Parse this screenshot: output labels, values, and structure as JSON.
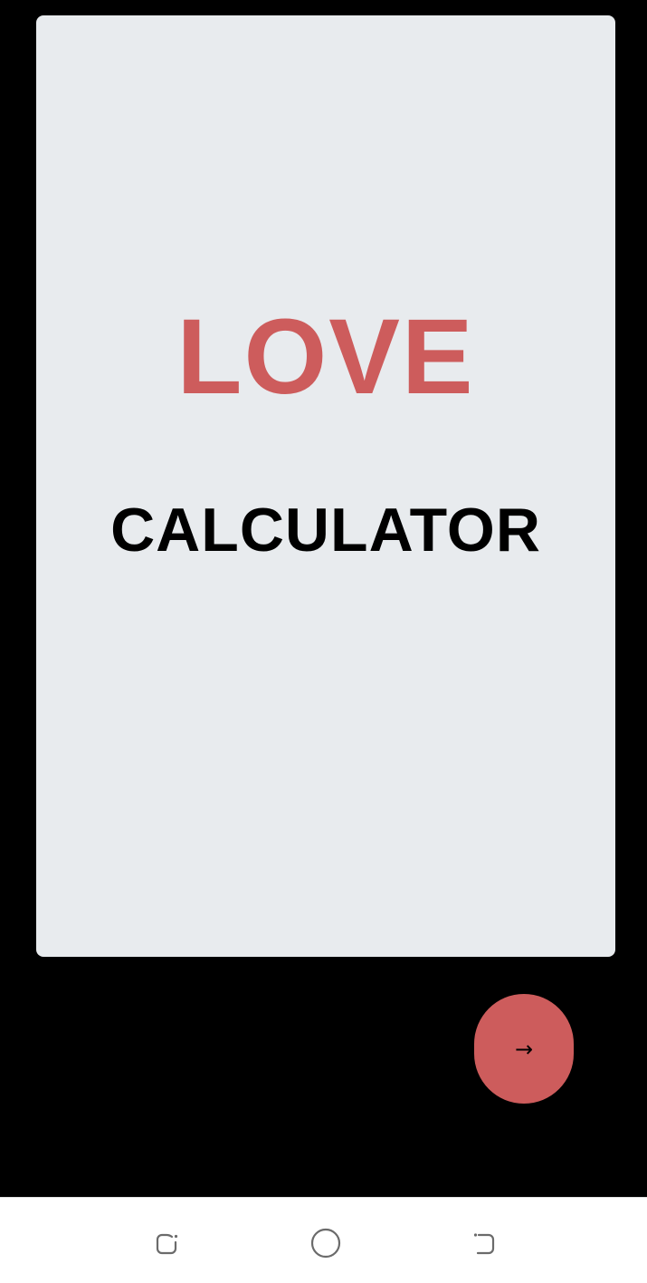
{
  "splash": {
    "title_top": "LOVE",
    "title_bottom": "CALCULATOR"
  },
  "next_button": {
    "label": "→",
    "icon": "arrow-right-icon"
  },
  "navbar": {
    "items": [
      {
        "icon": "recent-apps-icon"
      },
      {
        "icon": "home-icon"
      },
      {
        "icon": "back-icon"
      }
    ]
  },
  "colors": {
    "background": "#000000",
    "card": "#e8ebee",
    "accent": "#cd5c5c",
    "text": "#000000"
  }
}
